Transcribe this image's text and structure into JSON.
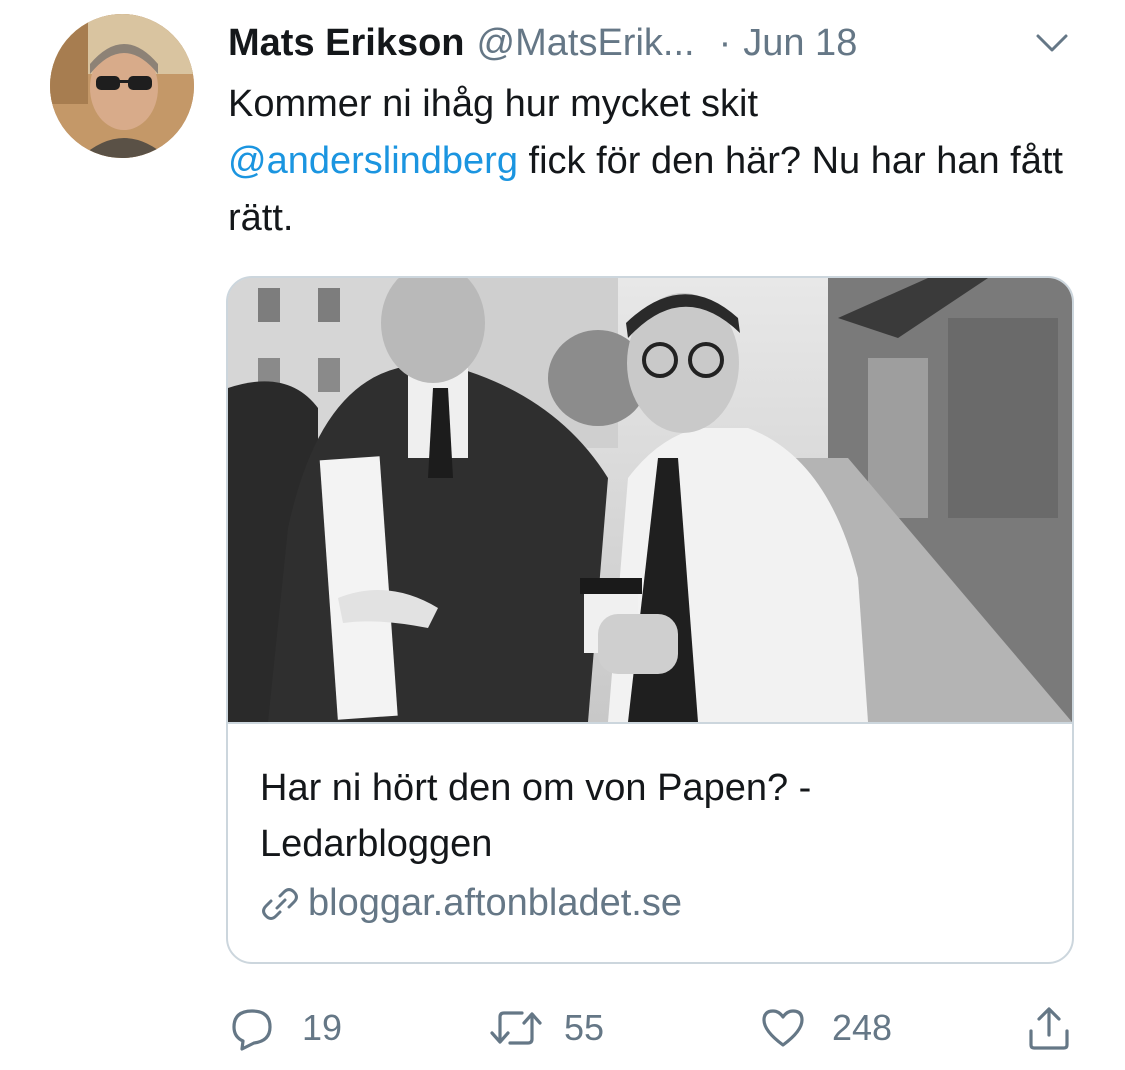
{
  "tweet": {
    "author": {
      "name": "Mats Erikson",
      "handle": "@MatsErik...",
      "avatar_icon": "user-avatar"
    },
    "separator": "·",
    "date": "Jun 18",
    "text": {
      "part1": "Kommer ni ihåg hur mycket skit",
      "mention": "@anderslindberg",
      "part2": " fick för den här? Nu har han fått rätt."
    },
    "card": {
      "image_icon": "photo",
      "title": "Har ni hört den om von Papen? - Ledarbloggen",
      "domain": "bloggar.aftonbladet.se"
    },
    "actions": {
      "reply_count": "19",
      "retweet_count": "55",
      "like_count": "248"
    }
  },
  "colors": {
    "text": "#14171a",
    "secondary": "#657786",
    "link": "#1b95e0",
    "border": "#ccd6dd"
  }
}
